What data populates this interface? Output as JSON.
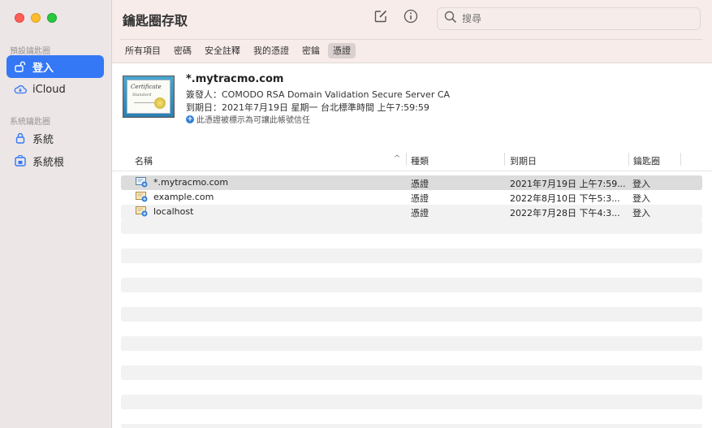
{
  "sidebar": {
    "section_default": "預設鑰匙圈",
    "section_system": "系統鑰匙圈",
    "items": [
      {
        "label": "登入",
        "icon": "unlocked-padlock-icon"
      },
      {
        "label": "iCloud",
        "icon": "cloud-icon"
      },
      {
        "label": "系統",
        "icon": "padlock-icon"
      },
      {
        "label": "系統根",
        "icon": "cabinet-lock-icon"
      }
    ]
  },
  "toolbar": {
    "title": "鑰匙圈存取",
    "search_placeholder": "搜尋",
    "tabs": [
      "所有項目",
      "密碼",
      "安全註釋",
      "我的憑證",
      "密鑰",
      "憑證"
    ],
    "active_tab": "憑證"
  },
  "certificate": {
    "name": "*.mytracmo.com",
    "issuer": "簽發人：COMODO RSA Domain Validation Secure Server CA",
    "expires": "到期日：2021年7月19日 星期一 台北標準時間 上午7:59:59",
    "trust_note": "此憑證被標示為可讓此帳號信任",
    "image_text_1": "Certificate",
    "image_text_2": "Standard"
  },
  "table": {
    "headers": {
      "name": "名稱",
      "kind": "種類",
      "expires": "到期日",
      "keychain": "鑰匙圈"
    },
    "sort_indicator": "^",
    "rows": [
      {
        "name": "*.mytracmo.com",
        "kind": "憑證",
        "expires": "2021年7月19日 上午7:59...",
        "keychain": "登入"
      },
      {
        "name": "example.com",
        "kind": "憑證",
        "expires": "2022年8月10日 下午5:3...",
        "keychain": "登入"
      },
      {
        "name": "localhost",
        "kind": "憑證",
        "expires": "2022年7月28日 下午4:3...",
        "keychain": "登入"
      }
    ]
  },
  "colors": {
    "accent": "#3478f6",
    "toolbar_bg": "#f8eceb",
    "sidebar_bg": "#ece6e6",
    "selected_row": "#dcdcdc"
  }
}
